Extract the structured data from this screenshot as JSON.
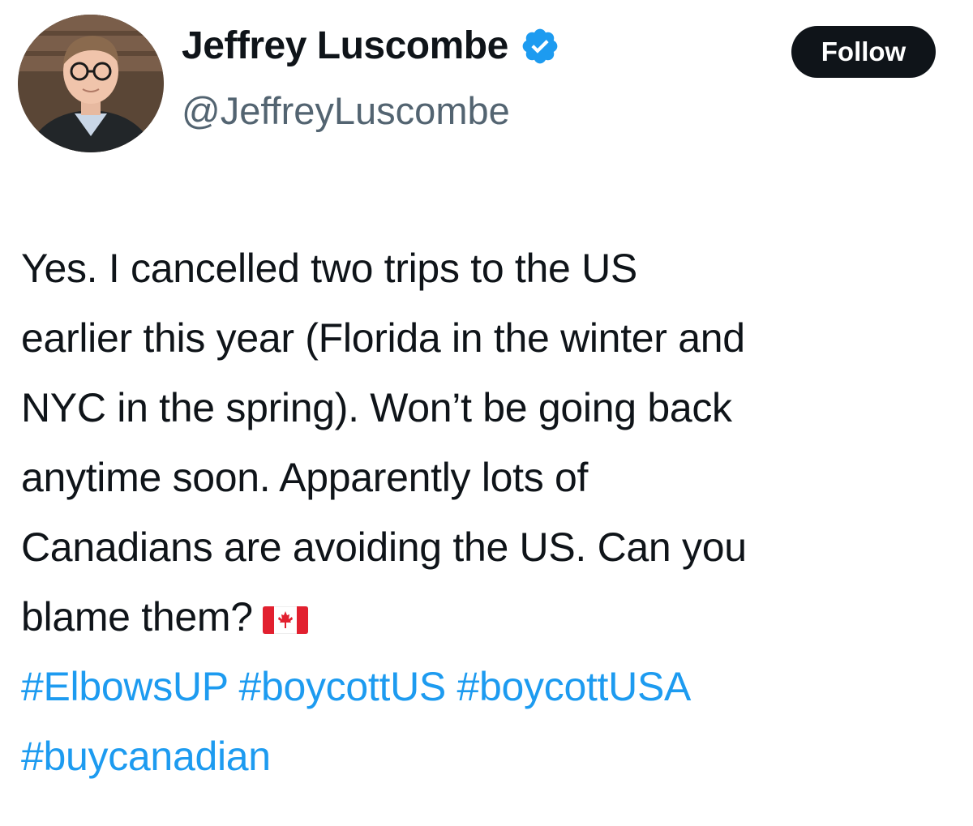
{
  "author": {
    "display_name": "Jeffrey Luscombe",
    "handle": "@JeffreyLuscombe",
    "verified": true,
    "avatar_icon": "profile-photo"
  },
  "actions": {
    "follow_label": "Follow"
  },
  "tweet": {
    "lines": [
      "Yes. I cancelled two trips to the US",
      "earlier this year (Florida in the winter and",
      "NYC in the spring). Won’t be going back",
      "anytime soon. Apparently lots of",
      "Canadians are avoiding the US. Can you",
      "blame them?"
    ],
    "emoji": "🇨🇦",
    "emoji_icon": "canada-flag-icon",
    "hashtags": [
      "#ElbowsUP",
      "#boycottUS",
      "#boycottUSA",
      "#buycanadian"
    ]
  },
  "colors": {
    "text": "#0f1419",
    "secondary": "#536471",
    "link": "#1d9bf0",
    "verified": "#1d9bf0",
    "follow_bg": "#0f1419"
  }
}
